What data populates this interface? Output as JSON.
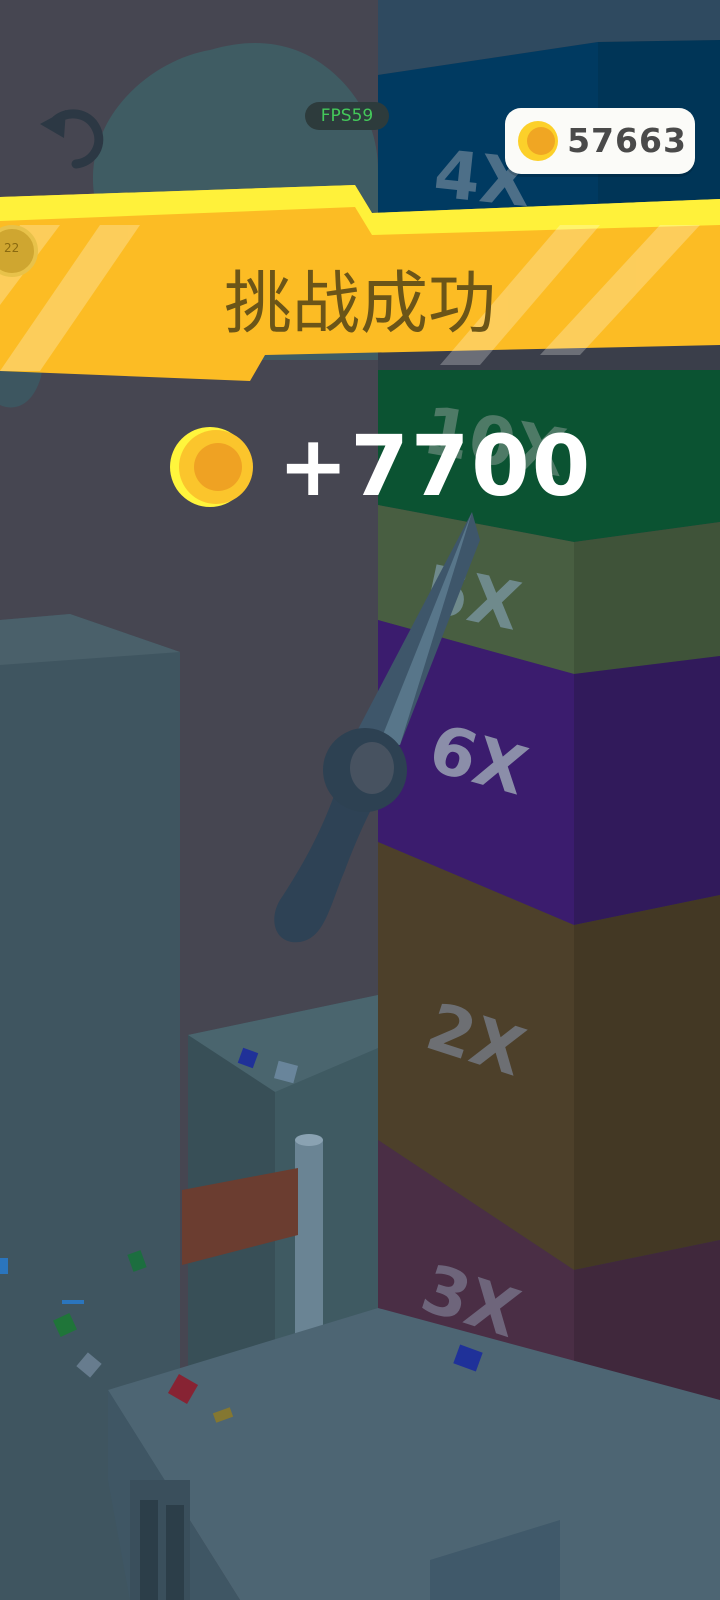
{
  "hud": {
    "fps_label": "FPS59",
    "coin_total": "57663",
    "level_badge": "22"
  },
  "banner": {
    "title": "挑战成功"
  },
  "reward": {
    "amount": "+7700"
  },
  "tower": {
    "multipliers": [
      {
        "label": "4X",
        "color": "#00385f"
      },
      {
        "label": "10X",
        "color": "#0c5230"
      },
      {
        "label": "5X",
        "color": "#475c3e"
      },
      {
        "label": "6X",
        "color": "#3a1c6c"
      },
      {
        "label": "2X",
        "color": "#4d3f2a"
      },
      {
        "label": "3X",
        "color": "#4a2d44"
      }
    ]
  },
  "icons": {
    "restart": "restart-icon",
    "coin": "coin-icon"
  },
  "colors": {
    "banner": "#ffbf24",
    "coin": "#fbc52c",
    "fps_text": "#44c85a"
  }
}
